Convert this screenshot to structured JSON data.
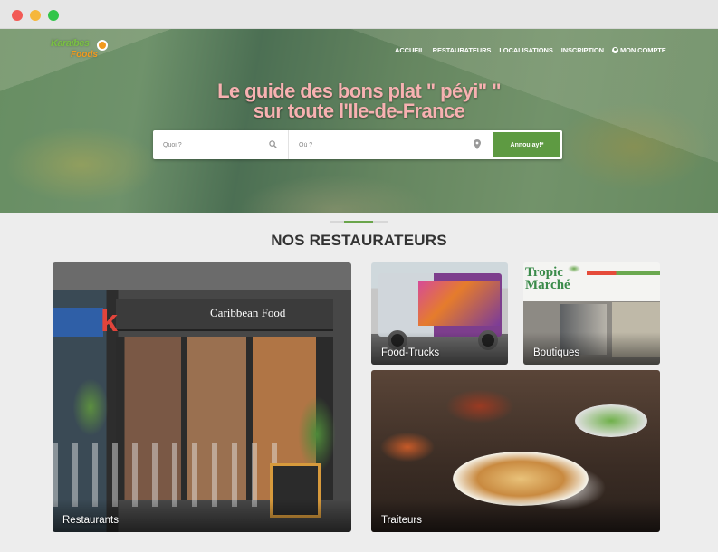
{
  "browser": {
    "controls": [
      "close",
      "minimize",
      "maximize"
    ]
  },
  "header": {
    "logo": {
      "line1": "Karaïbes",
      "line2": "Foods"
    },
    "nav": [
      {
        "label": "ACCUEIL"
      },
      {
        "label": "RESTAURATEURS"
      },
      {
        "label": "LOCALISATIONS"
      },
      {
        "label": "INSCRIPTION"
      },
      {
        "label": "MON COMPTE",
        "icon": "user-circle-icon"
      }
    ]
  },
  "hero": {
    "headline_line1": "Le guide des bons plat \" péyi\" \"",
    "headline_line2": "sur toute l'Ile-de-France",
    "search": {
      "what_placeholder": "Quoi ?",
      "where_placeholder": "Où ?",
      "button_label": "Annou ay!*",
      "what_icon": "search-icon",
      "where_icon": "map-pin-icon"
    }
  },
  "section": {
    "title": "NOS RESTAURATEURS",
    "cards": [
      {
        "label": "Restaurants",
        "sign": "Caribbean Food"
      },
      {
        "label": "Food-Trucks"
      },
      {
        "label": "Boutiques",
        "sign_line1": "Tropic",
        "sign_line2": "Marché"
      },
      {
        "label": "Traiteurs"
      }
    ]
  },
  "colors": {
    "accent_green": "#5e9a42",
    "headline_pink": "#f7b1b1",
    "title_text": "#333333"
  }
}
